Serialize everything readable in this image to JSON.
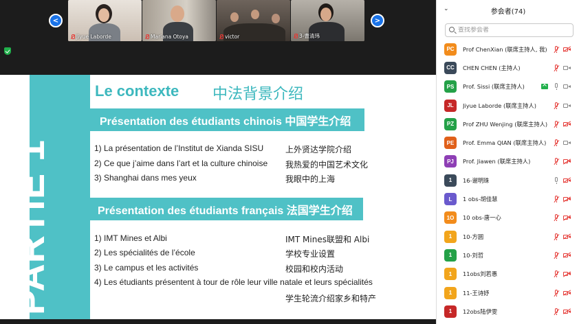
{
  "video_tiles": [
    {
      "name": "Jiyue Laborde"
    },
    {
      "name": "Mariana Otoya"
    },
    {
      "name": "victor"
    },
    {
      "name": "3-曹清玮"
    }
  ],
  "slide": {
    "side_text": "PARTIE 1",
    "title": "Le contexte",
    "title_cn": "中法背景介绍",
    "section1": {
      "heading": "Présentation des étudiants chinois 中国学生介绍",
      "items": [
        {
          "fr": "1)  La présentation de l’Institut de Xianda SISU",
          "cn": "上外贤达学院介绍"
        },
        {
          "fr": "2)  Ce que j’aime dans l’art et la culture chinoise",
          "cn": "我热爱的中国艺术文化"
        },
        {
          "fr": "3)  Shanghai dans mes yeux",
          "cn": "我眼中的上海"
        }
      ]
    },
    "section2": {
      "heading": "Présentation des étudiants français 法国学生介绍",
      "items": [
        {
          "fr": "1)  IMT Mines et Albi",
          "cn": "IMT Mines联盟和 Albi"
        },
        {
          "fr": "2)  Les spécialités de l’école",
          "cn": "学校专业设置"
        },
        {
          "fr": "3)  Le campus et les activités",
          "cn": "校园和校内活动"
        },
        {
          "fr": "4)  Les étudiants présentent à tour de rôle leur ville natale et leurs spécialités",
          "cn": "学生轮流介绍家乡和特产"
        }
      ]
    }
  },
  "panel": {
    "title": "参会者(74)",
    "search_placeholder": "查找参会者",
    "participants": [
      {
        "initials": "PC",
        "name": "Prof ChenXian (联席主持人, 我)",
        "color": "#f28c1c",
        "mic": "off",
        "cam": "off"
      },
      {
        "initials": "CC",
        "name": "CHEN CHEN (主持人)",
        "color": "#3b4a5a",
        "mic": "off",
        "cam": "on"
      },
      {
        "initials": "PS",
        "name": "Prof. Sissi (联席主持人)",
        "color": "#24a148",
        "mic": "on",
        "cam": "on",
        "sharing": true
      },
      {
        "initials": "JL",
        "name": "Jiyue Laborde (联席主持人)",
        "color": "#c62828",
        "mic": "off",
        "cam": "on"
      },
      {
        "initials": "PZ",
        "name": "Prof ZHU Wenjing (联席主持人)",
        "color": "#24a148",
        "mic": "off",
        "cam": "off"
      },
      {
        "initials": "PE",
        "name": "Prof. Emma QIAN (联席主持人)",
        "color": "#e0601a",
        "mic": "off",
        "cam": "on"
      },
      {
        "initials": "PJ",
        "name": "Prof. Jiawen (联席主持人)",
        "color": "#8e3fb5",
        "mic": "off",
        "cam": "off"
      },
      {
        "initials": "1",
        "name": "16-谢明珠",
        "color": "#3b4a5a",
        "mic": "on",
        "cam": "off"
      },
      {
        "initials": "L",
        "name": "1 obs-胡佳慧",
        "color": "#6a5acd",
        "mic": "off",
        "cam": "off"
      },
      {
        "initials": "1O",
        "name": "10 obs-唐一心",
        "color": "#f28c1c",
        "mic": "off",
        "cam": "off"
      },
      {
        "initials": "1",
        "name": "10-方圆",
        "color": "#f2a51c",
        "mic": "off",
        "cam": "off"
      },
      {
        "initials": "1",
        "name": "10-刘哲",
        "color": "#24a148",
        "mic": "off",
        "cam": "off"
      },
      {
        "initials": "1",
        "name": "11obs刘若愚",
        "color": "#f2a51c",
        "mic": "off",
        "cam": "off"
      },
      {
        "initials": "1",
        "name": "11-王诗妤",
        "color": "#f2a51c",
        "mic": "off",
        "cam": "off"
      },
      {
        "initials": "1",
        "name": "12obs陆伊雯",
        "color": "#c62828",
        "mic": "off",
        "cam": "off"
      }
    ]
  }
}
